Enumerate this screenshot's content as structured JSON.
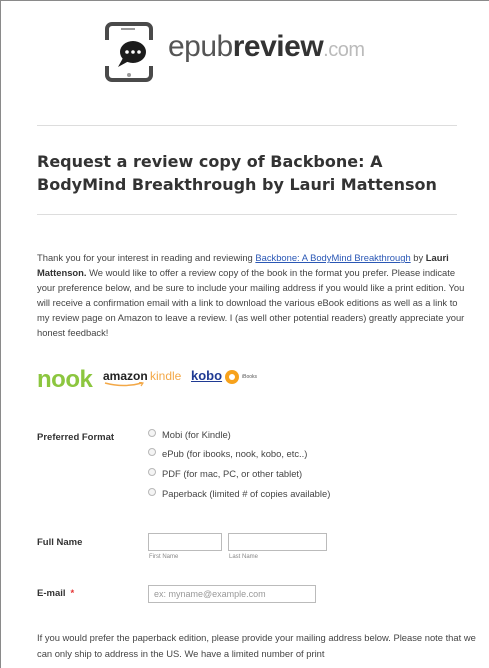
{
  "brand": {
    "name_light": "epub",
    "name_bold": "review",
    "name_suffix": ".com",
    "accent": "#2a57b5"
  },
  "heading": "Request a review copy of Backbone: A BodyMind Breakthrough by Lauri Mattenson",
  "intro": {
    "p1": "Thank you for your interest in reading and reviewing ",
    "link": "Backbone: A BodyMind Breakthrough",
    "p2": " by ",
    "author": "Lauri Mattenson.",
    "p3": "  We would like to offer a review copy of the book in the format you prefer.  Please indicate your preference below, and be sure to include your mailing address if you would like a print edition.  You will receive a confirmation email with a link to download the various eBook editions as well as a link to my review page on Amazon to leave a review.  I (as well other potential readers) greatly appreciate your honest feedback!"
  },
  "stores": {
    "nook": "nook",
    "amazon": "amazon",
    "kindle": "kindle",
    "kobo": "kobo",
    "ibooks": "iBooks"
  },
  "form": {
    "format_label": "Preferred Format",
    "format_options": [
      "Mobi (for Kindle)",
      "ePub (for ibooks, nook, kobo, etc..)",
      "PDF (for mac, PC, or other tablet)",
      "Paperback (limited # of copies available)"
    ],
    "name_label": "Full Name",
    "first_name_sublabel": "First Name",
    "last_name_sublabel": "Last Name",
    "first_name_value": "",
    "last_name_value": "",
    "email_label": "E-mail",
    "email_required": "*",
    "email_placeholder": "ex: myname@example.com"
  },
  "paperback_note": "If you would prefer the paperback edition, please provide your mailing address below.  Please note that we can only ship to address in the US.  We have a limited number of print"
}
